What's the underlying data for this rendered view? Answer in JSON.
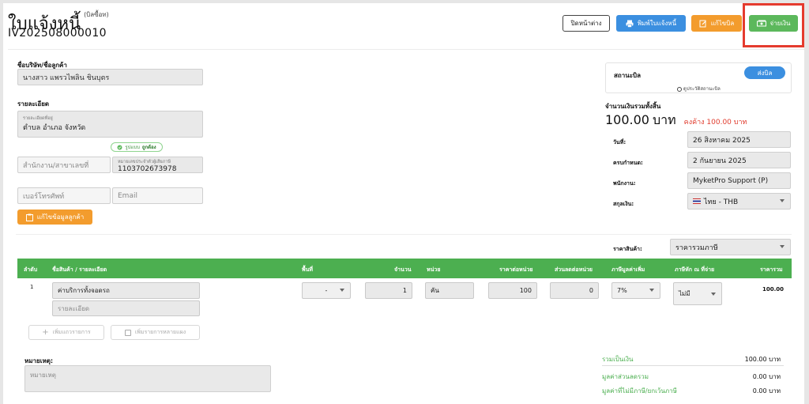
{
  "header": {
    "title": "ใบแจ้งหนี้",
    "title_note": "(บิลซื้อท)",
    "doc_number": "IV202508000010",
    "close_label": "ปิดหน้าต่าง",
    "print_label": "พิมพ์ใบแจ้งหนี้",
    "edit_label": "แก้ไขบิล",
    "pay_label": "จ่ายเงิน"
  },
  "customer": {
    "company_label": "ชื่อบริษัท/ชื่อลูกค้า",
    "company_value": "นางสาว แพรวไพลิน ชินบุตร",
    "detail_label": "รายละเอียด",
    "address_caption": "รายละเอียดที่อยู่",
    "address_value": "ตำบล อำเภอ จังหวัด",
    "verify_prefix": "รูปแบบ",
    "verify_state": "ถูกต้อง",
    "branch_placeholder": "สำนักงาน/สาขาเลขที่",
    "taxid_caption": "หมายเลขประจำตัวผู้เสียภาษี",
    "taxid_value": "1103702673978",
    "phone_placeholder": "เบอร์โทรศัพท์",
    "email_placeholder": "Email",
    "edit_customer_label": "แก้ไขข้อมูลลูกค้า"
  },
  "status": {
    "label": "สถานะบิล",
    "value": "ส่งบิล",
    "history": "ดูประวัติสถานะบิล"
  },
  "total": {
    "label": "จำนวนเงินรวมทั้งสิ้น",
    "amount": "100.00",
    "unit": "บาท",
    "outstanding": "คงค้าง 100.00 บาท"
  },
  "meta": {
    "date_label": "วันที่:",
    "date_value": "26 สิงหาคม 2025",
    "due_label": "ครบกำหนด:",
    "due_value": "2 กันยายน 2025",
    "staff_label": "พนักงาน:",
    "staff_value": "MyketPro Support (P)",
    "currency_label": "สกุลเงิน:",
    "currency_value": "ไทย - THB",
    "price_type_label": "ราคาสินค้า:",
    "price_type_value": "ราคารวมภาษี"
  },
  "table": {
    "headers": [
      "ลำดับ",
      "ชื่อสินค้า / รายละเอียด",
      "พื้นที่",
      "จำนวน",
      "หน่วย",
      "ราคาต่อหน่วย",
      "ส่วนลดต่อหน่วย",
      "ภาษีมูลค่าเพิ่ม",
      "ภาษีหัก ณ ที่จ่าย",
      "ราคารวม"
    ],
    "rows": [
      {
        "index": "1",
        "name": "ค่าบริการทั้งจอดรถ",
        "detail_placeholder": "รายละเอียด",
        "area": "-",
        "qty": "1",
        "unit": "คัน",
        "price": "100",
        "discount": "0",
        "vat": "7%",
        "wht": "ไม่มี",
        "total": "100.00"
      }
    ],
    "add_row_label": "เพิ่มแถวรายการ",
    "add_multi_label": "เพิ่มรายการหลายแผง"
  },
  "notes": {
    "label": "หมายเหตุ:",
    "placeholder": "หมายเหตุ"
  },
  "summary": {
    "items": [
      {
        "label": "รวมเป็นเงิน",
        "value": "100.00 บาท"
      },
      {
        "label": "มูลค่าส่วนลดรวม",
        "value": "0.00 บาท"
      },
      {
        "label": "มูลค่าที่ไม่มีภาษี/ยกเว้นภาษี",
        "value": "0.00 บาท"
      }
    ]
  },
  "colors": {
    "primary": "#3b8fe0",
    "warning": "#f39c2d",
    "success": "#4caf50",
    "danger": "#e53b2e"
  }
}
